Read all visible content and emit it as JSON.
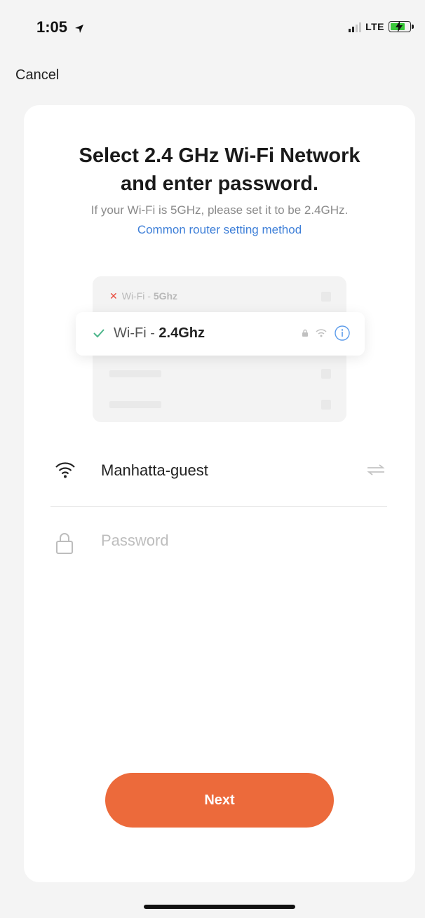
{
  "status_bar": {
    "time": "1:05",
    "network": "LTE"
  },
  "nav": {
    "cancel_label": "Cancel"
  },
  "header": {
    "title_line1": "Select 2.4 GHz Wi-Fi Network",
    "title_line2": "and enter password.",
    "subtitle": "If your Wi-Fi is 5GHz, please set it to be 2.4GHz.",
    "router_link": "Common router setting method"
  },
  "illustration": {
    "wifi_5_prefix": "Wi-Fi - ",
    "wifi_5_band": "5Ghz",
    "wifi_24_prefix": "Wi-Fi - ",
    "wifi_24_band": "2.4Ghz"
  },
  "form": {
    "ssid_value": "Manhatta-guest",
    "password_placeholder": "Password"
  },
  "actions": {
    "next_label": "Next"
  },
  "colors": {
    "accent": "#ec6a3b",
    "link": "#3e7fd8",
    "check": "#4bb58a",
    "error": "#e94a3c",
    "info": "#5b9bea"
  },
  "icons": [
    "location-arrow-icon",
    "signal-icon",
    "battery-icon",
    "close-icon",
    "check-icon",
    "lock-icon",
    "wifi-icon",
    "info-icon",
    "swap-icon"
  ]
}
